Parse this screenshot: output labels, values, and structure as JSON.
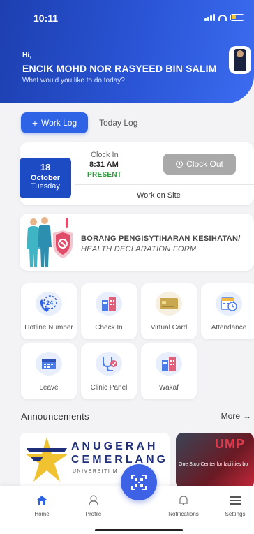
{
  "status_bar": {
    "time": "10:11"
  },
  "header": {
    "greeting": "Hi,",
    "name": "ENCIK MOHD NOR RASYEED BIN SALIM",
    "subtitle": "What would you like to do today?"
  },
  "tabs": {
    "active": "Work Log",
    "active_prefix": "+",
    "inactive": "Today Log"
  },
  "clock_card": {
    "day": "18",
    "month": "October",
    "weekday": "Tuesday",
    "clock_in_label": "Clock In",
    "clock_in_time": "8:31 AM",
    "status": "PRESENT",
    "clock_out_label": "Clock Out",
    "location": "Work on Site"
  },
  "health": {
    "title": "BORANG PENGISYTIHARAN KESIHATAN/",
    "subtitle": "HEALTH DECLARATION FORM"
  },
  "menu": [
    {
      "label": "Hotline Number",
      "icon": "phone-24-icon"
    },
    {
      "label": "Check In",
      "icon": "building-icon"
    },
    {
      "label": "Virtual Card",
      "icon": "card-icon"
    },
    {
      "label": "Attendance",
      "icon": "calendar-clock-icon"
    },
    {
      "label": "Leave",
      "icon": "calendar-icon"
    },
    {
      "label": "Clinic Panel",
      "icon": "stethoscope-icon"
    },
    {
      "label": "Wakaf",
      "icon": "building-icon"
    }
  ],
  "announcements": {
    "title": "Announcements",
    "more": "More",
    "banner1": {
      "line1": "ANUGERAH",
      "line2": "CEMERLANG",
      "line3": "UNIVERSITI M"
    },
    "banner2": {
      "head": "UMP",
      "text": "One Stop Center for facilities bo"
    }
  },
  "bottom_nav": [
    {
      "label": "Home",
      "icon": "home-icon"
    },
    {
      "label": "Profile",
      "icon": "profile-icon"
    },
    {
      "label": "Notifications",
      "icon": "bell-icon"
    },
    {
      "label": "Settings",
      "icon": "menu-icon"
    }
  ],
  "colors": {
    "primary": "#2f63e6",
    "header_dark": "#1d3fb0",
    "present": "#2e9a3e",
    "clockout_disabled": "#a9a9a9"
  }
}
